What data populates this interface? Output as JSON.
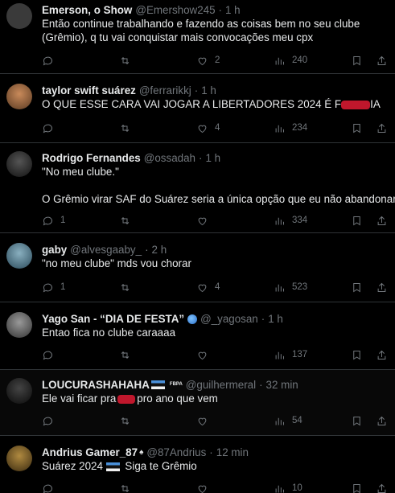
{
  "tweets": [
    {
      "name": "Emerson, o Show",
      "handle": "@Emershow245",
      "time": "1 h",
      "text": "Então continue trabalhando e fazendo as coisas bem no seu clube (Grêmio), q tu vai conquistar mais convocações meu cpx",
      "replies": "",
      "retweets": "",
      "likes": "2",
      "views": "240",
      "avatar_color": "#3a3a3a"
    },
    {
      "name": "taylor swift suárez",
      "handle": "@ferrarikkj",
      "time": "1 h",
      "text_before": "O QUE ESSE CARA VAI JOGAR A LIBERTADORES 2024 É F",
      "text_after": "IA",
      "replies": "",
      "retweets": "",
      "likes": "4",
      "views": "234",
      "avatar_color": "#8a5a3a"
    },
    {
      "name": "Rodrigo Fernandes",
      "handle": "@ossadah",
      "time": "1 h",
      "text_line1": "\"No meu clube.\"",
      "text_line2": "O Grêmio virar SAF do Suárez seria a única opção que eu não abandonaria.",
      "replies": "1",
      "retweets": "",
      "likes": "",
      "views": "334",
      "avatar_color": "#2a2a2a"
    },
    {
      "name": "gaby",
      "handle": "@alvesgaaby_",
      "time": "2 h",
      "text": "\"no meu clube\" mds vou chorar",
      "replies": "1",
      "retweets": "",
      "likes": "4",
      "views": "523",
      "avatar_color": "#4a6a7a"
    },
    {
      "name": "Yago San - “DIA DE FESTA”",
      "handle": "@_yagosan",
      "time": "1 h",
      "text": "Entao fica no clube caraaaa",
      "replies": "",
      "retweets": "",
      "likes": "",
      "views": "137",
      "avatar_color": "#555"
    },
    {
      "name": "LOUCURASHAHAHA",
      "badge": "FBPA",
      "handle": "@guilhermeral",
      "time": "32 min",
      "text_before": "Ele vai ficar pra",
      "text_after": "pro ano que vem",
      "replies": "",
      "retweets": "",
      "likes": "",
      "views": "54",
      "avatar_color": "#1a1a1a"
    },
    {
      "name": "Andrius Gamer_87",
      "handle": "@87Andrius",
      "time": "12 min",
      "text_before": "Suárez 2024",
      "text_after": "Siga te Grêmio",
      "replies": "",
      "retweets": "",
      "likes": "",
      "views": "10",
      "avatar_color": "#6a5a30"
    }
  ],
  "colors": {
    "text": "#e7e9ea",
    "muted": "#71767b",
    "border": "#2f3336",
    "redaction": "#c0172c"
  }
}
